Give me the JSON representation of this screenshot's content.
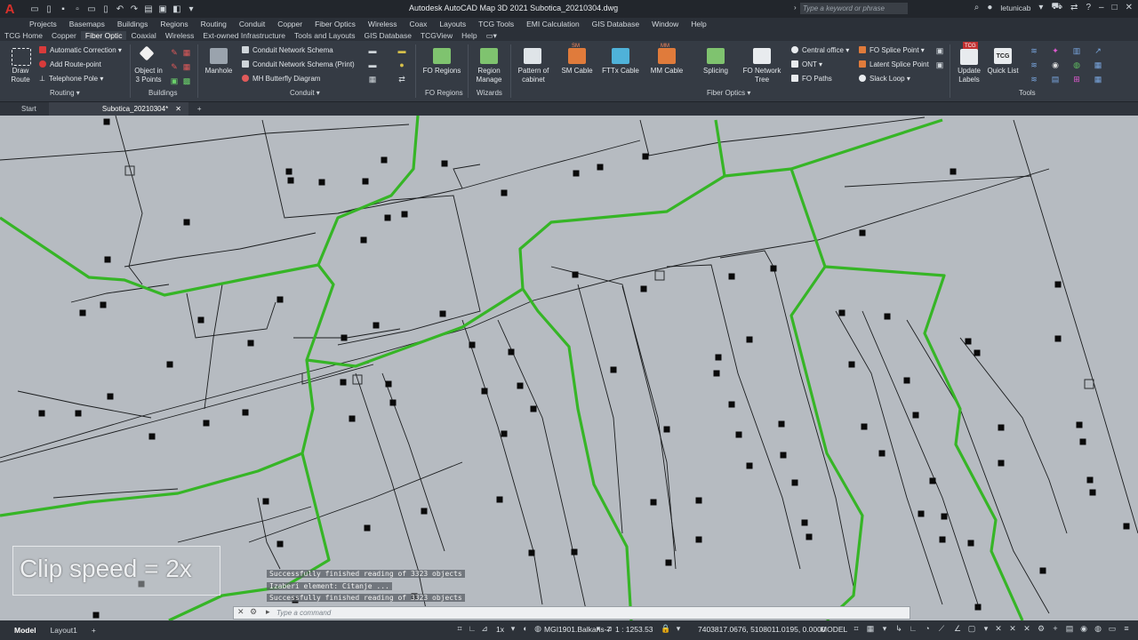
{
  "app": {
    "logo_letter": "A",
    "title": "Autodesk AutoCAD Map 3D 2021   Subotica_20210304.dwg",
    "search_placeholder": "Type a keyword or phrase",
    "user": "letunicab"
  },
  "menu": [
    "Projects",
    "Basemaps",
    "Buildings",
    "Regions",
    "Routing",
    "Conduit",
    "Copper",
    "Fiber Optics",
    "Wireless",
    "Coax",
    "Layouts",
    "TCG Tools",
    "EMI Calculation",
    "GIS Database",
    "Window",
    "Help"
  ],
  "ribbon_tabs": [
    "TCG Home",
    "Copper",
    "Fiber Optic",
    "Coaxial",
    "Wireless",
    "Ext-owned Infrastructure",
    "Tools and Layouts",
    "GIS Database",
    "TCGView",
    "Help"
  ],
  "ribbon_active_tab": "Fiber Optic",
  "ribbon": {
    "draw_route": "Draw Route",
    "automatic_correction": "Automatic Correction",
    "add_route_point": "Add Route-point",
    "telephone_pole": "Telephone Pole",
    "routing_panel": "Routing",
    "object_in_3_points": "Object in 3 Points",
    "buildings_panel": "Buildings",
    "manhole": "Manhole",
    "conduit_network_schema": "Conduit Network Schema",
    "conduit_network_schema_print": "Conduit Network Schema (Print)",
    "mh_butterfly_diagram": "MH Butterfly Diagram",
    "conduit_panel": "Conduit",
    "fo_regions": "FO Regions",
    "fo_regions_panel": "FO Regions",
    "region_manage": "Region Manage",
    "wizards_panel": "Wizards",
    "pattern_of_cabinet": "Pattern of cabinet",
    "sm_cable": "SM Cable",
    "fttx_cable": "FTTx Cable",
    "mm_cable": "MM Cable",
    "splicing": "Splicing",
    "fo_network_tree": "FO Network Tree",
    "central_office": "Central office",
    "ont": "ONT",
    "fo_paths": "FO Paths",
    "fo_splice_point": "FO Splice Point",
    "latent_splice_point": "Latent Splice Point",
    "slack_loop": "Slack Loop",
    "fiber_optics_panel": "Fiber Optics",
    "update_labels": "Update Labels",
    "quick_list": "Quick List",
    "tools_panel": "Tools",
    "sm_badge": "SM",
    "mm_badge": "MM",
    "tcg_badge": "TCG"
  },
  "doc_tabs": [
    "Start",
    "Subotica_20210304*"
  ],
  "command_log": [
    "Successfully finished reading of 3323 objects",
    "Izaberi element: Citanje ...",
    "Successfully finished reading of 3323 objects"
  ],
  "command_placeholder": "Type a command",
  "overlay": "Clip speed = 2x",
  "layout_tabs": [
    "Model",
    "Layout1"
  ],
  "status": {
    "scale_1x": "1x",
    "coord_system": "MGI1901.Balkans-7",
    "annotation_scale": "1 : 1253.53",
    "coordinates": "7403817.0676, 5108011.0195, 0.0000",
    "space": "MODEL"
  },
  "colors": {
    "canvas_bg": "#b6bbc1",
    "region_green": "#36b526",
    "route_line": "#1a1c1e",
    "ribbon_bg": "#353b44"
  }
}
